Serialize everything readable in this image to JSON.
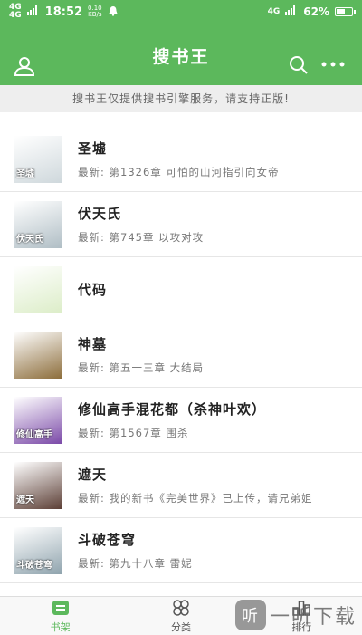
{
  "status_bar": {
    "signal_left": "4G",
    "signal_left_sub": "4G",
    "time": "18:52",
    "net_speed": "0.10",
    "net_speed_unit": "KB/s",
    "signal_right": "4G",
    "battery_text": "62%",
    "battery_level": 0.62
  },
  "appbar": {
    "title": "搜书王"
  },
  "notice": "搜书王仅提供搜书引擎服务，请支持正版!",
  "books": [
    {
      "name": "圣墟",
      "latest": "最新: 第1326章 可怕的山河指引向女帝",
      "cover_text": "圣墟",
      "cover_color": "#cfd8dc"
    },
    {
      "name": "伏天氏",
      "latest": "最新: 第745章 以攻对攻",
      "cover_text": "伏天氏",
      "cover_color": "#b0bec5"
    },
    {
      "name": "代码",
      "latest": "",
      "cover_text": "",
      "cover_color": "#dcedc8"
    },
    {
      "name": "神墓",
      "latest": "最新: 第五一三章 大结局",
      "cover_text": "",
      "cover_color": "#8d6e3c"
    },
    {
      "name": "修仙高手混花都（杀神叶欢）",
      "latest": "最新: 第1567章 围杀",
      "cover_text": "修仙高手",
      "cover_color": "#7b4aa8"
    },
    {
      "name": "遮天",
      "latest": "最新: 我的新书《完美世界》已上传，请兄弟姐",
      "cover_text": "遮天",
      "cover_color": "#5d4037"
    },
    {
      "name": "斗破苍穹",
      "latest": "最新: 第九十八章 雷妮",
      "cover_text": "斗破苍穹",
      "cover_color": "#90a4ae"
    }
  ],
  "tabs": [
    {
      "label": "书架",
      "icon": "bookshelf-icon"
    },
    {
      "label": "分类",
      "icon": "category-icon"
    },
    {
      "label": "排行",
      "icon": "ranking-icon"
    }
  ],
  "watermark": {
    "badge": "听",
    "text": "一听下载"
  },
  "colors": {
    "primary": "#5cb85c"
  }
}
